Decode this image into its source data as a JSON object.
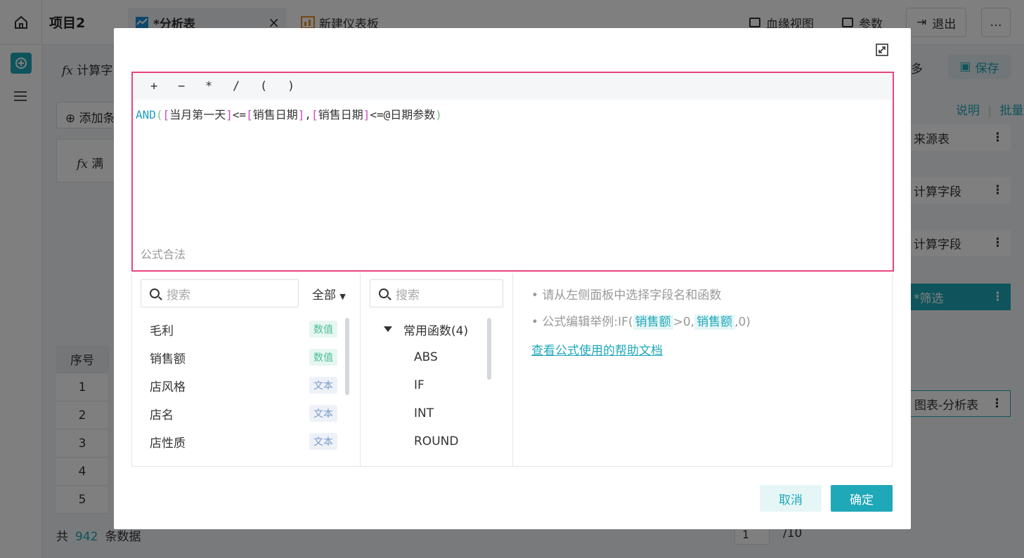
{
  "header": {
    "project": "项目2",
    "active_tab": "*分析表",
    "active_tab_close": "×",
    "second_tab": "新建仪表板",
    "lineage": "血缘视图",
    "params": "参数",
    "exit": "退出",
    "more": "…"
  },
  "background": {
    "calc_field": "计算字",
    "add_condition": "添加条",
    "fx_card": "满",
    "table_header": "序号",
    "rows": [
      "1",
      "2",
      "3",
      "4",
      "5"
    ],
    "footer_prefix": "共",
    "footer_count": "942",
    "footer_suffix": "条数据",
    "page_current": "1",
    "page_total": "/10"
  },
  "right_panel": {
    "duo": "多",
    "save": "保存",
    "explain": "说明",
    "batch": "批量",
    "items": [
      "来源表",
      "计算字段",
      "计算字段",
      "*筛选",
      "图表-分析表"
    ]
  },
  "modal": {
    "operators": [
      "+",
      "−",
      "*",
      "/",
      "(",
      ")"
    ],
    "formula": {
      "fn": "AND",
      "open": "(",
      "lb1": "[",
      "f1": "当月第一天",
      "rb1": "]",
      "op1": "<=",
      "lb2": "[",
      "f2": "销售日期",
      "rb2": "]",
      "comma": ",",
      "lb3": "[",
      "f3": "销售日期",
      "rb3": "]",
      "op2": "<=@",
      "f4": "日期参数",
      "close": ")"
    },
    "validation": "公式合法",
    "field_search_placeholder": "搜索",
    "field_filter": "全部",
    "fields": [
      {
        "name": "毛利",
        "type": "数值"
      },
      {
        "name": "销售额",
        "type": "数值"
      },
      {
        "name": "店风格",
        "type": "文本"
      },
      {
        "name": "店名",
        "type": "文本"
      },
      {
        "name": "店性质",
        "type": "文本"
      }
    ],
    "func_search_placeholder": "搜索",
    "func_group": "常用函数(4)",
    "functions": [
      "ABS",
      "IF",
      "INT",
      "ROUND"
    ],
    "tip1": "请从左侧面板中选择字段名和函数",
    "tip2_prefix": "公式编辑举例:IF(",
    "tip2_field1": "销售额",
    "tip2_mid": ">0,",
    "tip2_field2": "销售额",
    "tip2_suffix": ",0)",
    "help_link": "查看公式使用的帮助文档",
    "cancel": "取消",
    "confirm": "确定"
  }
}
